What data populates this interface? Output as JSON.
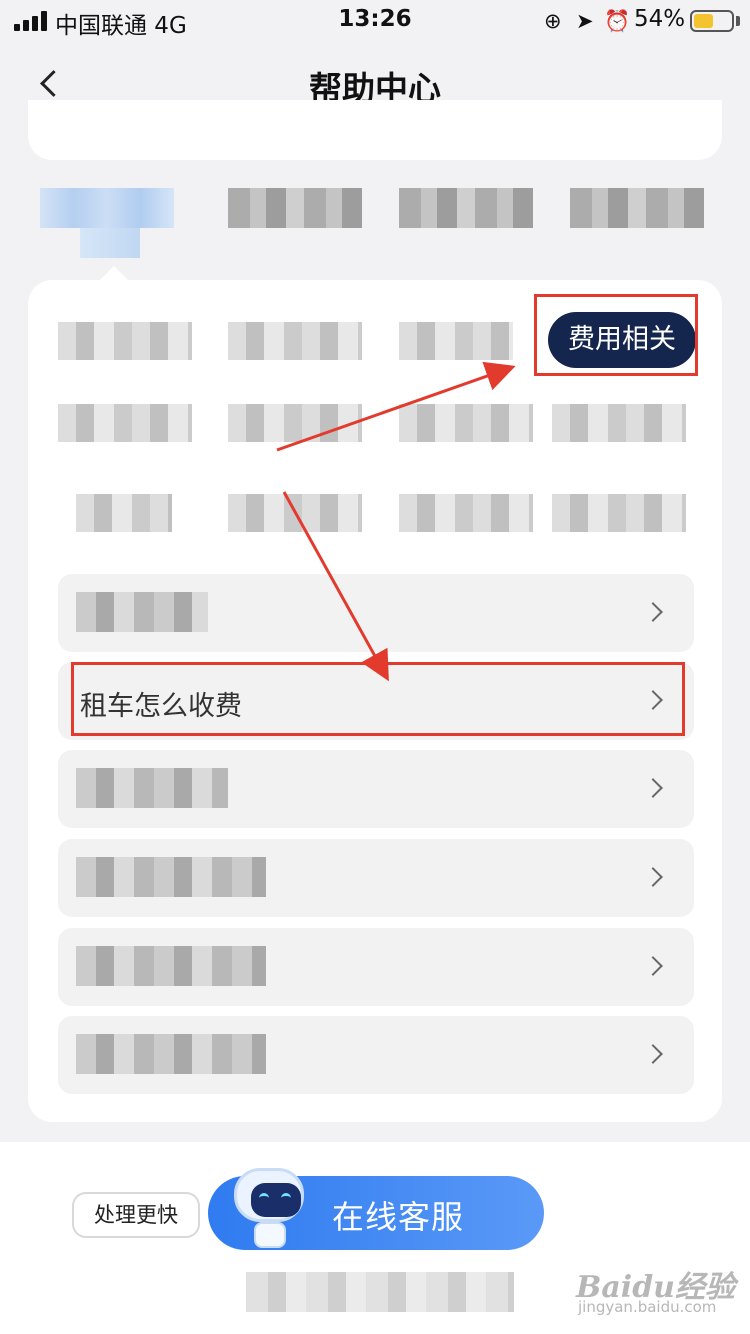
{
  "status_bar": {
    "carrier": "中国联通  4G",
    "time": "13:26",
    "battery_percent": "54%",
    "battery_level": 0.54,
    "icons": [
      "signal-icon",
      "rotation-lock-icon",
      "location-icon",
      "alarm-icon",
      "battery-icon"
    ]
  },
  "nav": {
    "title": "帮助中心",
    "back_icon": "chevron-left-icon"
  },
  "tabs": {
    "count": 4,
    "active_index": 0
  },
  "subcategories": {
    "highlighted_label": "费用相关",
    "highlight_color": "#14254e"
  },
  "faq_list": {
    "highlighted_item": "租车怎么收费",
    "row_icon": "chevron-right-icon",
    "row_count": 6
  },
  "annotation_color": "#e23b2e",
  "bottom": {
    "badge": "处理更快",
    "service_button": "在线客服",
    "button_color": "#2f7bf0"
  },
  "watermark": {
    "logo": "Baidu经验",
    "url": "jingyan.baidu.com"
  }
}
